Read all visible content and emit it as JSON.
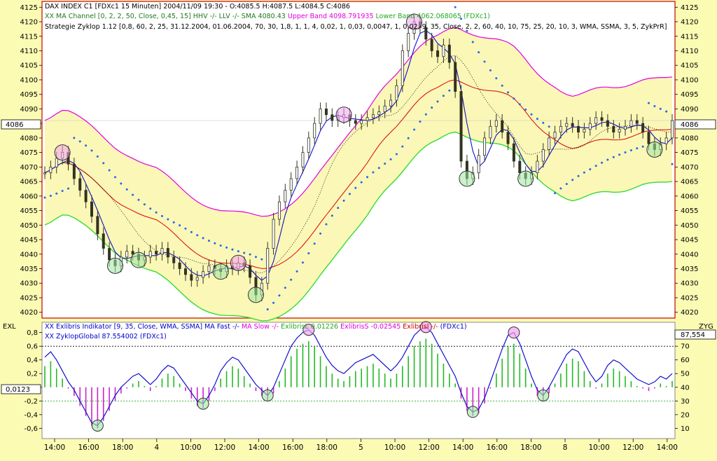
{
  "chart_data": [
    {
      "type": "candlestick",
      "header": {
        "line1": "DAX INDEX C1 [FDXc1  15 Minuten] 2004/11/09 19:30 - O:4085.5 H:4087.5 L:4084.5 C:4086",
        "line2_parts": [
          {
            "text": "XX MA Channel [0, 2, 2, 50, Close, 0,45, 15] HHV -/- LLV -/- SMA 4080.43 ",
            "color": "#1f7a1f"
          },
          {
            "text": "Upper Band 4098.791935 ",
            "color": "#e200e2"
          },
          {
            "text": "Lower Band 4062.068065 (FDXc1)",
            "color": "#22aa22"
          }
        ],
        "line3": "Strategie Zyklop 1.12 [0,8, 60, 2, 25, 31.12.2004, 01.06.2004, 70, 30, 1,8, 1, 1, 4, 0,02, 1, 0,03, 0,0047, 1, 0,02, 9, 35, Close, 2, 2, 60, 40, 10, 75, 25, 20, 10, 3, WMA, SSMA, 3, 5, ZykPrR]"
      },
      "y_ticks": [
        "4125",
        "4120",
        "4115",
        "4110",
        "4105",
        "4100",
        "4095",
        "4090",
        "4085",
        "4080",
        "4075",
        "4070",
        "4065",
        "4060",
        "4055",
        "4050",
        "4045",
        "4040",
        "4035",
        "4030",
        "4025",
        "4020"
      ],
      "ylim": [
        4018,
        4127
      ],
      "last_price_label": "4086",
      "last_price": 4086,
      "close": [
        4068,
        4070,
        4073,
        4075,
        4071,
        4066,
        4062,
        4058,
        4053,
        4047,
        4042,
        4038,
        4036,
        4039,
        4041,
        4040,
        4038,
        4039,
        4041,
        4040,
        4042,
        4039,
        4037,
        4035,
        4033,
        4031,
        4032,
        4034,
        4036,
        4035,
        4034,
        4036,
        4035,
        4037,
        4036,
        4032,
        4026,
        4030,
        4042,
        4052,
        4058,
        4062,
        4066,
        4070,
        4075,
        4080,
        4085,
        4090,
        4088,
        4086,
        4087,
        4088,
        4086,
        4085,
        4086,
        4087,
        4088,
        4089,
        4091,
        4093,
        4098,
        4110,
        4116,
        4120,
        4118,
        4114,
        4110,
        4108,
        4112,
        4106,
        4096,
        4072,
        4066,
        4068,
        4074,
        4080,
        4084,
        4086,
        4082,
        4078,
        4072,
        4068,
        4066,
        4068,
        4072,
        4076,
        4080,
        4082,
        4084,
        4085,
        4084,
        4082,
        4083,
        4085,
        4087,
        4086,
        4084,
        4082,
        4083,
        4084,
        4086,
        4085,
        4082,
        4078,
        4076,
        4078,
        4080,
        4086
      ]
    },
    {
      "type": "line+histogram",
      "header": {
        "line1_parts": [
          {
            "text": "XX Exlibris Indikator [9, 35, Close, WMA, SSMA] MA Fast -/- ",
            "color": "#0000cc"
          },
          {
            "text": "MA Slow -/- ",
            "color": "#e200e2"
          },
          {
            "text": "ExlibrisL 0.01226 ",
            "color": "#22aa22"
          },
          {
            "text": "ExlibrisS -0.02545 ",
            "color": "#e200e2"
          },
          {
            "text": "ExlibrisI -/- ",
            "color": "#cc0000"
          },
          {
            "text": "(FDXc1)",
            "color": "#0000cc"
          }
        ],
        "line2": "XX ZyklopGlobal 87.554002 (FDXc1)"
      },
      "left_axis_title": "EXL",
      "right_axis_title": "ZYG",
      "left_ticks": [
        "0,8",
        "0,6",
        "0,4",
        "0,2",
        "0",
        "-0,2",
        "-0,4",
        "-0,6"
      ],
      "right_ticks": [
        "80",
        "70",
        "60",
        "50",
        "40",
        "30",
        "20",
        "10"
      ],
      "left_value_label": "0,0123",
      "right_value_label": "87,554",
      "zyklop_global": [
        62,
        66,
        60,
        52,
        44,
        38,
        30,
        22,
        14,
        12,
        18,
        26,
        34,
        40,
        44,
        48,
        50,
        46,
        42,
        46,
        52,
        56,
        54,
        48,
        42,
        36,
        30,
        28,
        34,
        42,
        52,
        58,
        62,
        60,
        54,
        48,
        42,
        38,
        34,
        40,
        50,
        60,
        70,
        76,
        80,
        82,
        78,
        70,
        62,
        56,
        52,
        50,
        54,
        58,
        60,
        62,
        64,
        60,
        56,
        52,
        56,
        62,
        70,
        78,
        82,
        84,
        80,
        72,
        64,
        56,
        48,
        36,
        26,
        22,
        24,
        32,
        44,
        56,
        68,
        78,
        80,
        72,
        60,
        48,
        38,
        34,
        40,
        48,
        56,
        64,
        68,
        66,
        58,
        50,
        44,
        48,
        56,
        60,
        58,
        54,
        50,
        46,
        44,
        42,
        44,
        48,
        46,
        50
      ]
    }
  ],
  "x_axis": {
    "labels": [
      "14:00",
      "16:00",
      "18:00",
      "4",
      "10:00",
      "12:00",
      "14:00",
      "16:00",
      "18:00",
      "5",
      "10:00",
      "12:00",
      "14:00",
      "16:00",
      "18:00",
      "8",
      "10:00",
      "12:00",
      "14:00"
    ]
  }
}
